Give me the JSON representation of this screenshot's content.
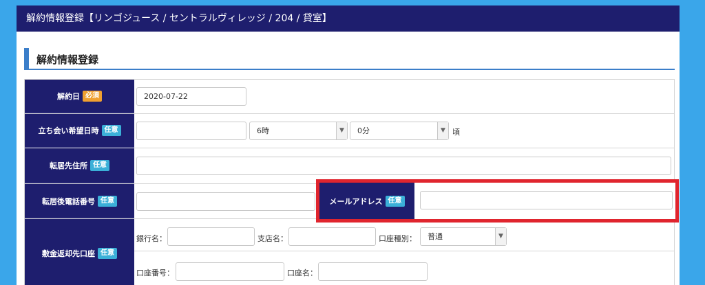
{
  "window": {
    "title": "解約情報登録【リンゴジュース / セントラルヴィレッジ / 204 / 貸室】"
  },
  "section": {
    "title": "解約情報登録"
  },
  "badges": {
    "required": "必須",
    "optional": "任意"
  },
  "form": {
    "cancel_date": {
      "label": "解約日",
      "value": "2020-07-22"
    },
    "visit": {
      "label": "立ち会い希望日時",
      "date_value": "",
      "hour": "6時",
      "minute": "0分",
      "suffix": "頃"
    },
    "new_address": {
      "label": "転居先住所",
      "value": ""
    },
    "new_phone": {
      "label": "転居後電話番号",
      "value": ""
    },
    "email": {
      "label": "メールアドレス",
      "value": ""
    },
    "refund": {
      "label": "敷金返却先口座",
      "bank_label": "銀行名：",
      "branch_label": "支店名：",
      "type_label": "口座種別：",
      "type_value": "普通",
      "number_label": "口座番号：",
      "name_label": "口座名："
    }
  },
  "colors": {
    "header": "#1e1e6e",
    "accent": "#3b7ec9",
    "highlight": "#e0252e",
    "required_badge": "#f0a030",
    "optional_badge": "#3bb0d8",
    "background": "#3aa6ea"
  },
  "icons": {
    "select_arrow": "chevron-down-icon"
  }
}
